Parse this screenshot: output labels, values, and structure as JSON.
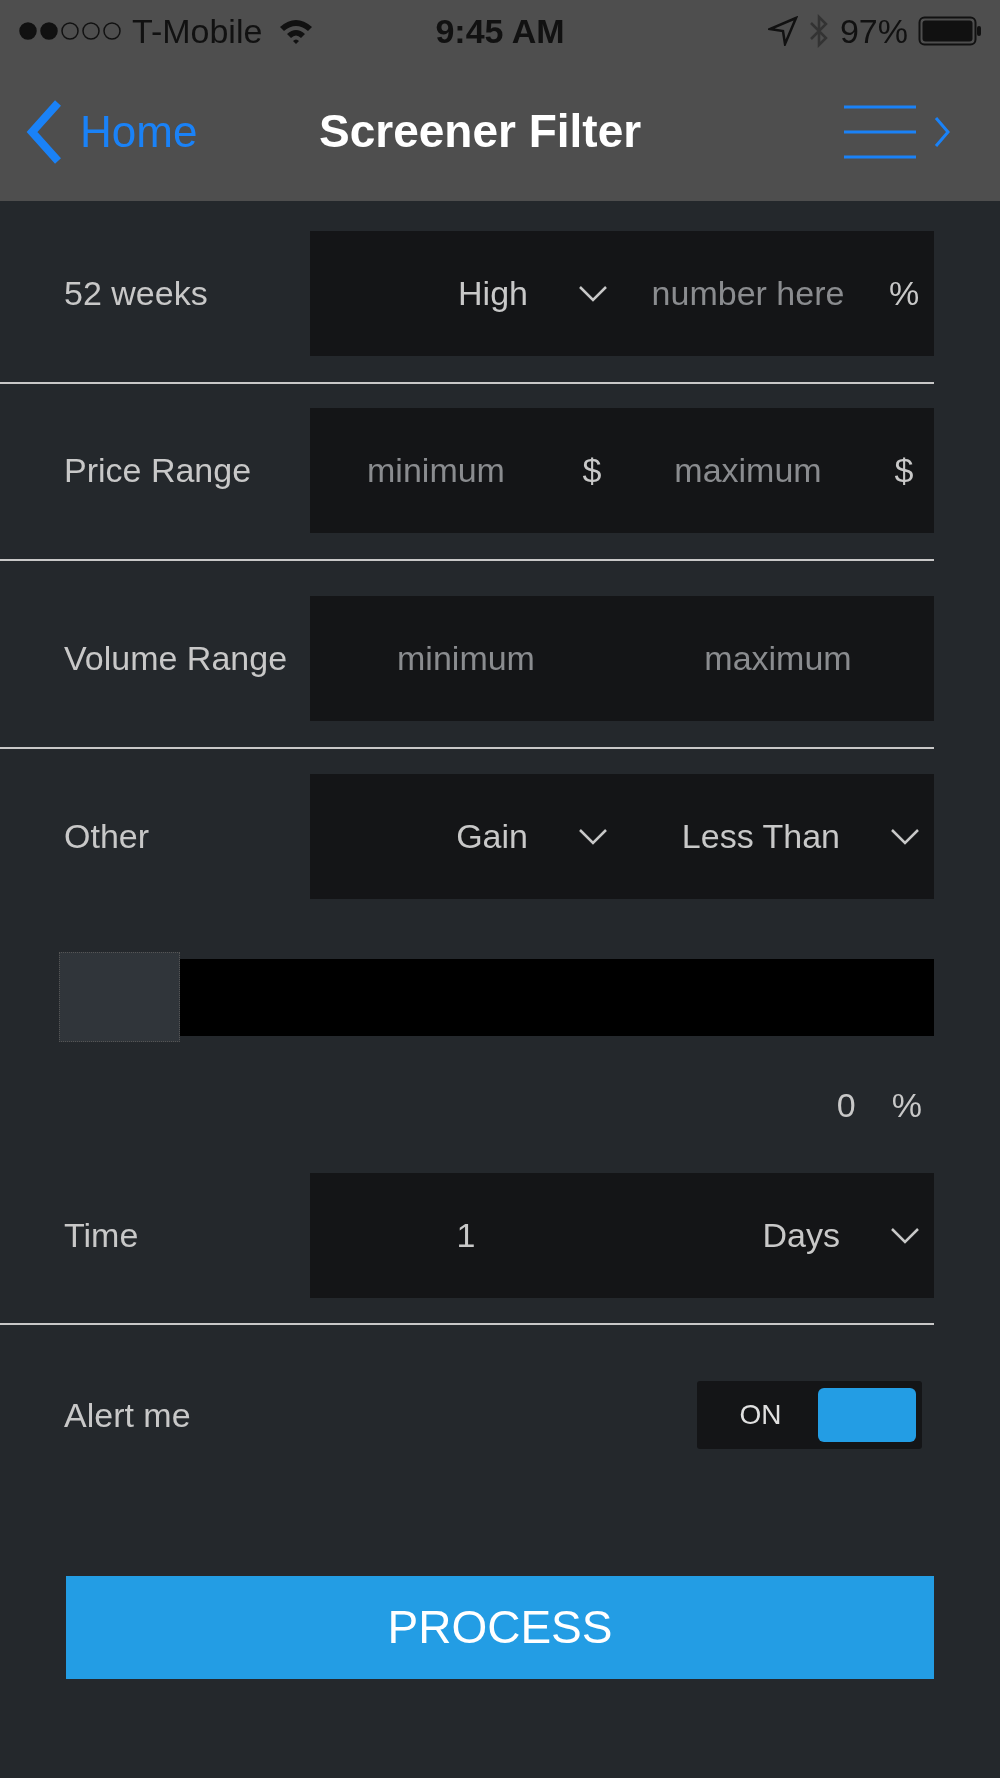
{
  "status_bar": {
    "carrier": "T-Mobile",
    "time": "9:45 AM",
    "battery": "97%"
  },
  "nav": {
    "back": "Home",
    "title": "Screener Filter"
  },
  "rows": [
    {
      "label": "52 weeks",
      "divider": true,
      "cells": [
        {
          "kind": "select",
          "value": "High"
        },
        {
          "kind": "input",
          "placeholder": "number here",
          "unit": "%"
        }
      ]
    },
    {
      "label": "Price Range",
      "divider": true,
      "cells": [
        {
          "kind": "input",
          "placeholder": "minimum",
          "unit": "$"
        },
        {
          "kind": "input",
          "placeholder": "maximum",
          "unit": "$"
        }
      ]
    },
    {
      "label": "Volume Range",
      "divider": true,
      "cells": [
        {
          "kind": "input",
          "placeholder": "minimum"
        },
        {
          "kind": "input",
          "placeholder": "maximum"
        }
      ]
    },
    {
      "label": "Other",
      "divider": false,
      "cells": [
        {
          "kind": "select",
          "value": "Gain"
        },
        {
          "kind": "select",
          "value": "Less Than"
        }
      ]
    }
  ],
  "slider": {
    "level": 0,
    "reading": "0",
    "unit": "%"
  },
  "time_row": {
    "label": "Time",
    "divider": true,
    "cells": [
      {
        "kind": "input",
        "value": "1"
      },
      {
        "kind": "select",
        "value": "Days"
      }
    ]
  },
  "alert": {
    "label": "Alert me",
    "toggle_text": "ON",
    "on": true
  },
  "process_button": "PROCESS"
}
